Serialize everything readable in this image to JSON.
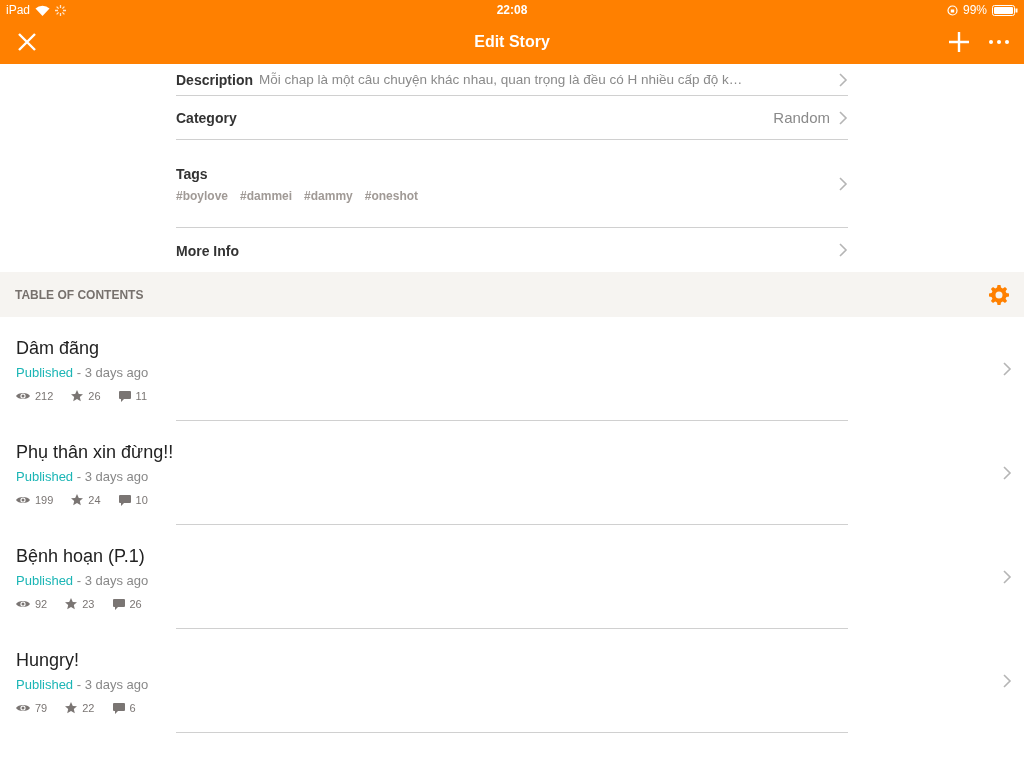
{
  "status_bar": {
    "carrier": "iPad",
    "time": "22:08",
    "battery": "99%"
  },
  "nav_bar": {
    "title": "Edit Story"
  },
  "details": [
    {
      "kind": "inline",
      "label": "Description",
      "value": "Mỗi chap là một câu chuyện khác nhau, quan trọng là đều có H nhiều cấp độ k…"
    },
    {
      "kind": "value",
      "label": "Category",
      "value": "Random"
    },
    {
      "kind": "tags",
      "label": "Tags",
      "tags": [
        "#boylove",
        "#dammei",
        "#dammy",
        "#oneshot"
      ]
    },
    {
      "kind": "plain",
      "label": "More Info"
    }
  ],
  "table_of_contents": {
    "header": "TABLE OF CONTENTS",
    "chapters": [
      {
        "title": "Dâm đãng",
        "status": "Published",
        "time": " - 3 days ago",
        "views": "212",
        "votes": "26",
        "comments": "11"
      },
      {
        "title": "Phụ thân xin đừng!!",
        "status": "Published",
        "time": " - 3 days ago",
        "views": "199",
        "votes": "24",
        "comments": "10"
      },
      {
        "title": "Bệnh hoạn (P.1)",
        "status": "Published",
        "time": " - 3 days ago",
        "views": "92",
        "votes": "23",
        "comments": "26"
      },
      {
        "title": "Hungry!",
        "status": "Published",
        "time": " - 3 days ago",
        "views": "79",
        "votes": "22",
        "comments": "6"
      }
    ]
  }
}
